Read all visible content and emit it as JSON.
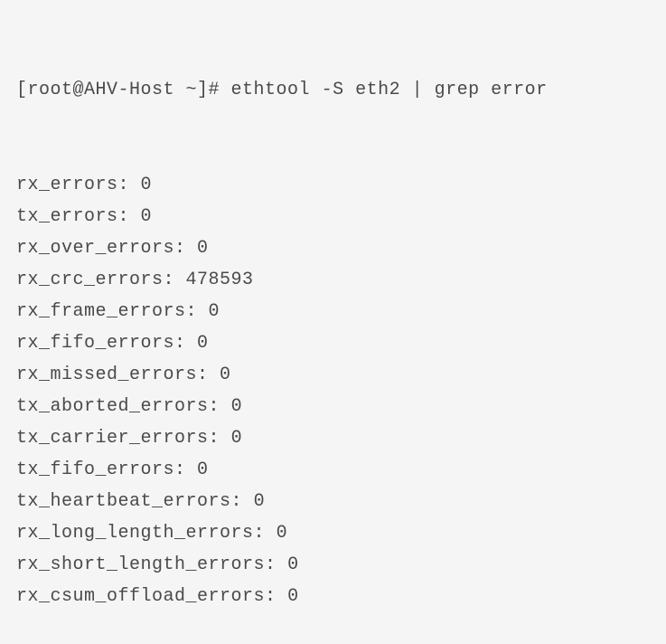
{
  "terminal": {
    "prompt": "[root@AHV-Host ~]# ",
    "command": "ethtool -S eth2 | grep error",
    "output": [
      {
        "label": "rx_errors",
        "value": "0"
      },
      {
        "label": "tx_errors",
        "value": "0"
      },
      {
        "label": "rx_over_errors",
        "value": "0"
      },
      {
        "label": "rx_crc_errors",
        "value": "478593"
      },
      {
        "label": "rx_frame_errors",
        "value": "0"
      },
      {
        "label": "rx_fifo_errors",
        "value": "0"
      },
      {
        "label": "rx_missed_errors",
        "value": "0"
      },
      {
        "label": "tx_aborted_errors",
        "value": "0"
      },
      {
        "label": "tx_carrier_errors",
        "value": "0"
      },
      {
        "label": "tx_fifo_errors",
        "value": "0"
      },
      {
        "label": "tx_heartbeat_errors",
        "value": "0"
      },
      {
        "label": "rx_long_length_errors",
        "value": "0"
      },
      {
        "label": "rx_short_length_errors",
        "value": "0"
      },
      {
        "label": "rx_csum_offload_errors",
        "value": "0"
      }
    ]
  }
}
